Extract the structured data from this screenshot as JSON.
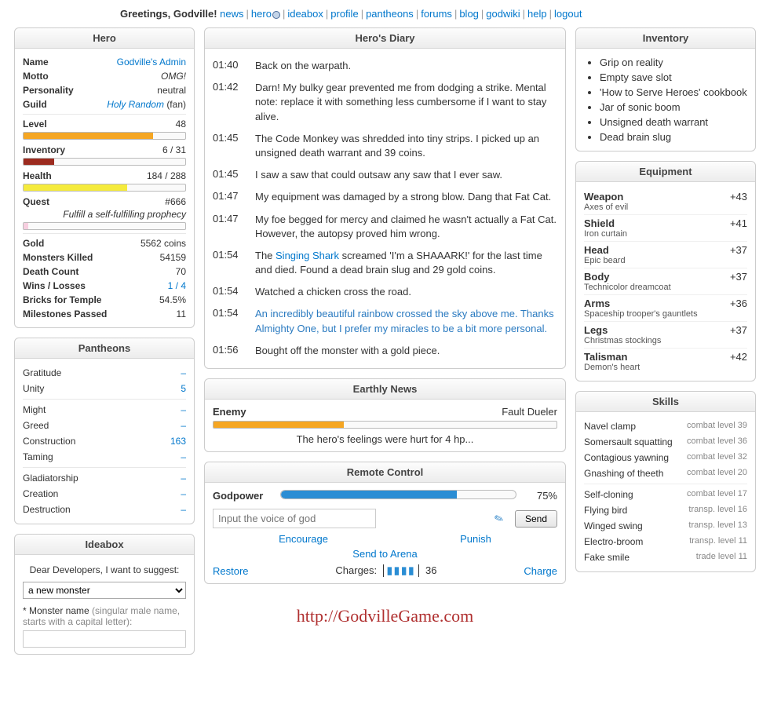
{
  "header": {
    "greeting": "Greetings, Godville!",
    "nav": [
      "news",
      "hero",
      "ideabox",
      "profile",
      "pantheons",
      "forums",
      "blog",
      "godwiki",
      "help",
      "logout"
    ]
  },
  "hero": {
    "title": "Hero",
    "name_label": "Name",
    "name": "Godville's Admin",
    "motto_label": "Motto",
    "motto": "OMG!",
    "personality_label": "Personality",
    "personality": "neutral",
    "guild_label": "Guild",
    "guild": "Holy Random",
    "guild_rank": "(fan)",
    "level_label": "Level",
    "level": "48",
    "level_pct": 80,
    "inventory_label": "Inventory",
    "inventory": "6 / 31",
    "inventory_pct": 19,
    "health_label": "Health",
    "health": "184 / 288",
    "health_pct": 64,
    "quest_label": "Quest",
    "quest_num": "#666",
    "quest_text": "Fulfill a self-fulfilling prophecy",
    "quest_pct": 3,
    "gold_label": "Gold",
    "gold": "5562 coins",
    "monsters_label": "Monsters Killed",
    "monsters": "54159",
    "deaths_label": "Death Count",
    "deaths": "70",
    "wl_label": "Wins / Losses",
    "wl": "1 / 4",
    "bricks_label": "Bricks for Temple",
    "bricks": "54.5%",
    "miles_label": "Milestones Passed",
    "miles": "11"
  },
  "pantheons": {
    "title": "Pantheons",
    "groups": [
      [
        {
          "name": "Gratitude",
          "val": "–"
        },
        {
          "name": "Unity",
          "val": "5",
          "link": true
        }
      ],
      [
        {
          "name": "Might",
          "val": "–"
        },
        {
          "name": "Greed",
          "val": "–"
        },
        {
          "name": "Construction",
          "val": "163",
          "link": true
        },
        {
          "name": "Taming",
          "val": "–"
        }
      ],
      [
        {
          "name": "Gladiatorship",
          "val": "–"
        },
        {
          "name": "Creation",
          "val": "–"
        },
        {
          "name": "Destruction",
          "val": "–"
        }
      ]
    ]
  },
  "ideabox": {
    "title": "Ideabox",
    "intro": "Dear Developers, I want to suggest:",
    "selected": "a new monster",
    "label_prefix": "* Monster name",
    "label_hint": "(singular male name, starts with a capital letter):"
  },
  "diary": {
    "title": "Hero's Diary",
    "entries": [
      {
        "t": "01:40",
        "txt": "Back on the warpath."
      },
      {
        "t": "01:42",
        "txt": "Darn! My bulky gear prevented me from dodging a strike. Mental note: replace it with something less cumbersome if I want to stay alive."
      },
      {
        "t": "01:45",
        "txt": "The Code Monkey was shredded into tiny strips. I picked up an unsigned death warrant and 39 coins."
      },
      {
        "t": "01:45",
        "txt": "I saw a saw that could outsaw any saw that I ever saw."
      },
      {
        "t": "01:47",
        "txt": "My equipment was damaged by a strong blow. Dang that Fat Cat."
      },
      {
        "t": "01:47",
        "txt": "My foe begged for mercy and claimed he wasn't actually a Fat Cat. However, the autopsy proved him wrong."
      },
      {
        "t": "01:54",
        "pre": "The ",
        "link": "Singing Shark",
        "post": " screamed 'I'm a SHAAARK!' for the last time and died. Found a dead brain slug and 29 gold coins."
      },
      {
        "t": "01:54",
        "txt": "Watched a chicken cross the road."
      },
      {
        "t": "01:54",
        "txt": "An incredibly beautiful rainbow crossed the sky above me. Thanks Almighty One, but I prefer my miracles to be a bit more personal.",
        "blue": true
      },
      {
        "t": "01:56",
        "txt": "Bought off the monster with a gold piece."
      }
    ]
  },
  "news": {
    "title": "Earthly News",
    "enemy_label": "Enemy",
    "enemy": "Fault Dueler",
    "enemy_hp_pct": 38,
    "msg": "The hero's feelings were hurt for 4 hp..."
  },
  "rc": {
    "title": "Remote Control",
    "godpower_label": "Godpower",
    "godpower_pct": 75,
    "godpower_txt": "75%",
    "placeholder": "Input the voice of god",
    "send": "Send",
    "encourage": "Encourage",
    "punish": "Punish",
    "arena": "Send to Arena",
    "restore": "Restore",
    "charges_label": "Charges:",
    "charges": "36",
    "charge": "Charge"
  },
  "inventory": {
    "title": "Inventory",
    "items": [
      "Grip on reality",
      "Empty save slot",
      "'How to Serve Heroes' cookbook",
      "Jar of sonic boom",
      "Unsigned death warrant",
      "Dead brain slug"
    ]
  },
  "equipment": {
    "title": "Equipment",
    "slots": [
      {
        "slot": "Weapon",
        "item": "Axes of evil",
        "val": "+43"
      },
      {
        "slot": "Shield",
        "item": "Iron curtain",
        "val": "+41"
      },
      {
        "slot": "Head",
        "item": "Epic beard",
        "val": "+37"
      },
      {
        "slot": "Body",
        "item": "Technicolor dreamcoat",
        "val": "+37"
      },
      {
        "slot": "Arms",
        "item": "Spaceship trooper's gauntlets",
        "val": "+36"
      },
      {
        "slot": "Legs",
        "item": "Christmas stockings",
        "val": "+37"
      },
      {
        "slot": "Talisman",
        "item": "Demon's heart",
        "val": "+42"
      }
    ]
  },
  "skills": {
    "title": "Skills",
    "groups": [
      [
        {
          "name": "Navel clamp",
          "lvl": "combat level 39"
        },
        {
          "name": "Somersault squatting",
          "lvl": "combat level 36"
        },
        {
          "name": "Contagious yawning",
          "lvl": "combat level 32"
        },
        {
          "name": "Gnashing of theeth",
          "lvl": "combat level 20"
        }
      ],
      [
        {
          "name": "Self-cloning",
          "lvl": "combat level 17"
        },
        {
          "name": "Flying bird",
          "lvl": "transp. level 16"
        },
        {
          "name": "Winged swing",
          "lvl": "transp. level 13"
        },
        {
          "name": "Electro-broom",
          "lvl": "transp. level 11"
        },
        {
          "name": "Fake smile",
          "lvl": "trade level 11"
        }
      ]
    ]
  },
  "footer_url": "http://GodvilleGame.com"
}
